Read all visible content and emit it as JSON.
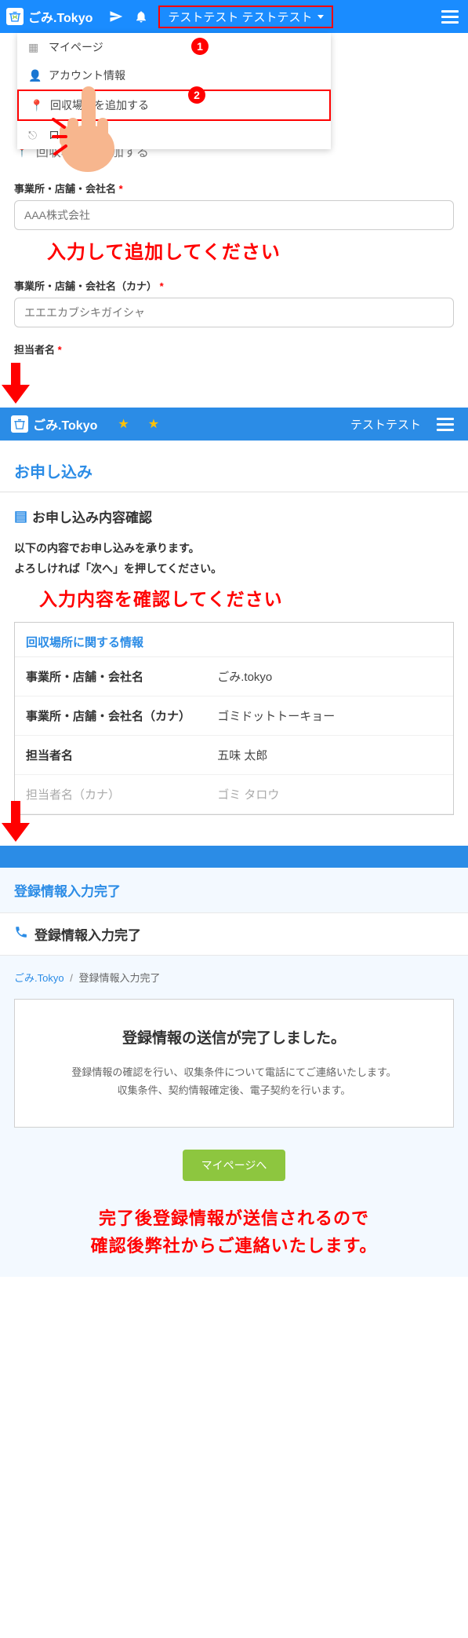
{
  "header": {
    "logo_text": "ごみ.Tokyo",
    "user_name": "テストテスト テストテスト",
    "dropdown": {
      "mypage": "マイページ",
      "account": "アカウント情報",
      "add_location": "回収場所を追加する",
      "logout": "ログアウト"
    }
  },
  "badge1": "1",
  "badge2": "2",
  "form": {
    "title": "回収場所を追加する",
    "company_label": "事業所・店舗・会社名",
    "company_placeholder": "AAA株式会社",
    "note1": "入力して追加してください",
    "kana_label": "事業所・店舗・会社名（カナ）",
    "kana_placeholder": "エエエカブシキガイシャ",
    "person_label": "担当者名"
  },
  "section2": {
    "logo_text": "ごみ.Tokyo",
    "user2": "テストテスト",
    "page_title": "お申し込み",
    "sec_title": "お申し込み内容確認",
    "desc1": "以下の内容でお申し込みを承ります。",
    "desc2": "よろしければ「次へ」を押してください。",
    "note2": "入力内容を確認してください",
    "info_title": "回収場所に関する情報",
    "rows": [
      {
        "label": "事業所・店舗・会社名",
        "value": "ごみ.tokyo"
      },
      {
        "label": "事業所・店舗・会社名（カナ）",
        "value": "ゴミドットトーキョー"
      },
      {
        "label": "担当者名",
        "value": "五味 太郎"
      },
      {
        "label": "担当者名（カナ）",
        "value": "ゴミ タロウ"
      }
    ]
  },
  "section3": {
    "page_title": "登録情報入力完了",
    "sec_title": "登録情報入力完了",
    "crumb_home": "ごみ.Tokyo",
    "crumb_sep": "/",
    "crumb_current": "登録情報入力完了",
    "done_title": "登録情報の送信が完了しました。",
    "done_text1": "登録情報の確認を行い、収集条件について電話にてご連絡いたします。",
    "done_text2": "収集条件、契約情報確定後、電子契約を行います。",
    "btn_mypage": "マイページへ",
    "note3a": "完了後登録情報が送信されるので",
    "note3b": "確認後弊社からご連絡いたします。"
  }
}
